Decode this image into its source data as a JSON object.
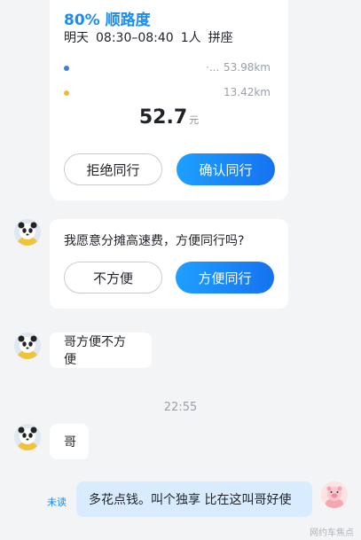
{
  "trip_card": {
    "header": "80% 顺路度",
    "day": "明天",
    "time_range": "08:30–08:40",
    "passengers": "1人",
    "ride_type": "拼座",
    "route": [
      {
        "place": "·...",
        "distance": "53.98km",
        "color": "#3b82d6"
      },
      {
        "place": "",
        "distance": "13.42km",
        "color": "#f5b740"
      }
    ],
    "price": "52.7",
    "price_unit": "元",
    "reject_label": "拒绝同行",
    "confirm_label": "确认同行"
  },
  "messages": [
    {
      "question": "我愿意分摊高速费，方便同行吗?",
      "decline": "不方便",
      "accept": "方便同行"
    },
    {
      "text": "哥方便不方便"
    },
    {
      "text": "哥"
    }
  ],
  "timestamp": "22:55",
  "outgoing": {
    "status": "未读",
    "text": "多花点钱。叫个独享  比在这叫哥好使"
  },
  "watermark": "网约车焦点"
}
